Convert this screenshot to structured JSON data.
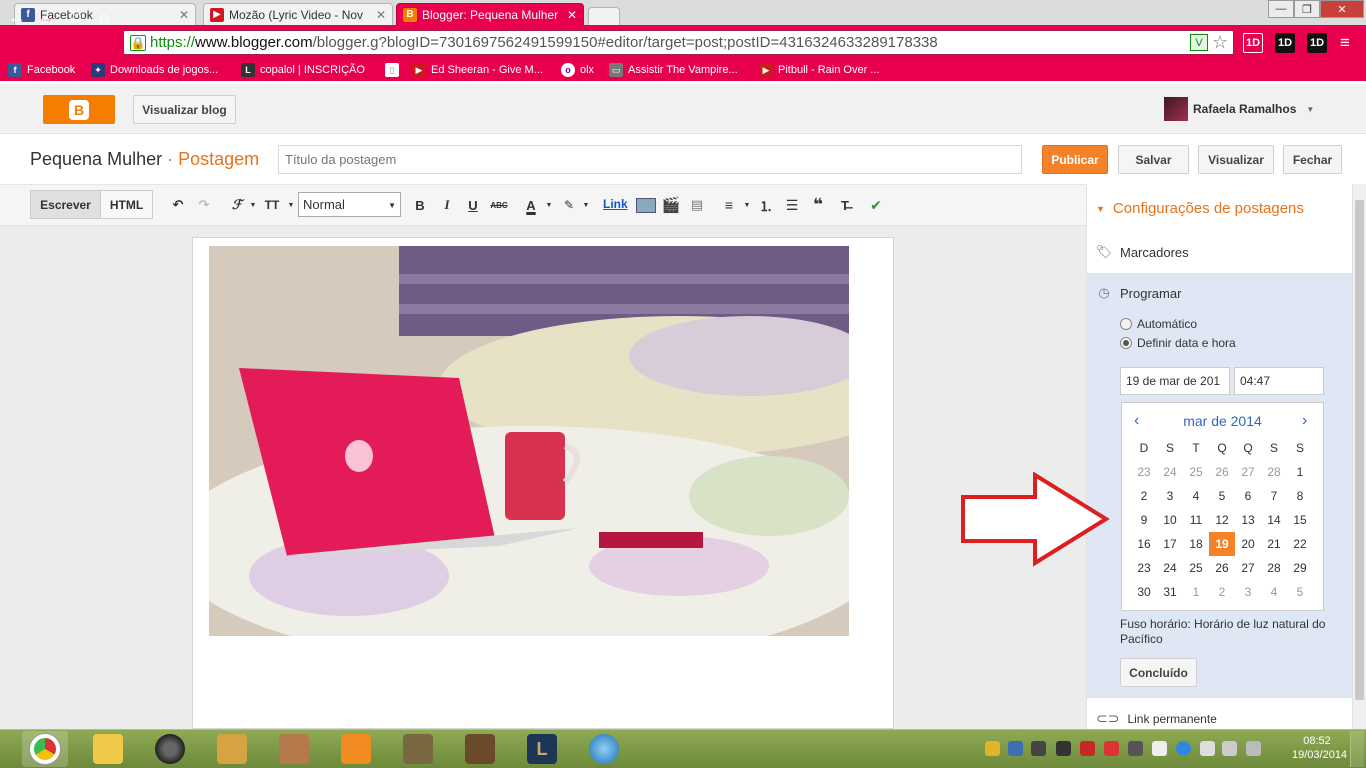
{
  "browser": {
    "tabs": [
      {
        "label": "Facebook",
        "icon": "facebook-icon",
        "color": "#3b5998"
      },
      {
        "label": "Mozão (Lyric Video - Nov",
        "icon": "youtube-icon",
        "color": "#cc181e"
      },
      {
        "label": "Blogger: Pequena Mulher",
        "icon": "blogger-icon",
        "color": "#f57d00"
      }
    ],
    "url_https": "https://",
    "url_domain": "www.blogger.com",
    "url_path": "/blogger.g?blogID=7301697562491599150#editor/target=post;postID=4316324633289178338",
    "extensions": [
      "1D",
      "1D",
      "1D"
    ],
    "bookmarks": [
      {
        "label": "Facebook",
        "color": "#3b5998"
      },
      {
        "label": "Downloads de jogos...",
        "color": "#2a3a7a"
      },
      {
        "label": "copalol | INSCRIÇÃO",
        "color": "#333333"
      },
      {
        "label": "",
        "color": "#ffffff"
      },
      {
        "label": "Ed Sheeran - Give M...",
        "color": "#cc181e"
      },
      {
        "label": "olx",
        "color": "#6e0ad6"
      },
      {
        "label": "Assistir The Vampire...",
        "color": "#555555"
      },
      {
        "label": "Pitbull - Rain Over ...",
        "color": "#cc181e"
      }
    ]
  },
  "header": {
    "view_blog": "Visualizar blog",
    "user_name": "Rafaela Ramalhos"
  },
  "post": {
    "blog_name": "Pequena Mulher",
    "separator": "·",
    "section": "Postagem",
    "title_placeholder": "Título da postagem",
    "publish": "Publicar",
    "save": "Salvar",
    "preview": "Visualizar",
    "close": "Fechar"
  },
  "toolbar": {
    "compose": "Escrever",
    "html": "HTML",
    "format": "Normal",
    "link": "Link"
  },
  "settings": {
    "title": "Configurações de postagens",
    "labels": "Marcadores",
    "schedule": "Programar",
    "auto": "Automático",
    "set_date": "Definir data e hora",
    "date_value": "19 de mar de 201",
    "time_value": "04:47",
    "calendar_month": "mar de 2014",
    "weekdays": [
      "D",
      "S",
      "T",
      "Q",
      "Q",
      "S",
      "S"
    ],
    "weeks": [
      [
        "23",
        "24",
        "25",
        "26",
        "27",
        "28",
        "1"
      ],
      [
        "2",
        "3",
        "4",
        "5",
        "6",
        "7",
        "8"
      ],
      [
        "9",
        "10",
        "11",
        "12",
        "13",
        "14",
        "15"
      ],
      [
        "16",
        "17",
        "18",
        "19",
        "20",
        "21",
        "22"
      ],
      [
        "23",
        "24",
        "25",
        "26",
        "27",
        "28",
        "29"
      ],
      [
        "30",
        "31",
        "1",
        "2",
        "3",
        "4",
        "5"
      ]
    ],
    "selected_day": "19",
    "timezone": "Fuso horário: Horário de luz natural do Pacífico",
    "done": "Concluído",
    "permalink": "Link permanente"
  },
  "taskbar": {
    "time": "08:52",
    "date": "19/03/2014"
  },
  "colors": {
    "chrome_theme": "#e8004e",
    "blogger_orange": "#f48229",
    "annotation_arrow": "#dd1f1f"
  }
}
